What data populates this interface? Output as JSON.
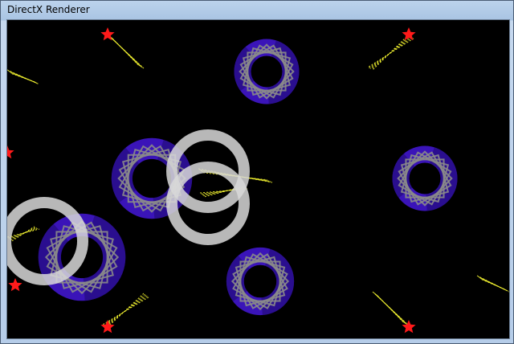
{
  "window": {
    "title": "DirectX Renderer"
  },
  "scene": {
    "background": "#000000",
    "colors": {
      "ring_purple": "#3a14b8",
      "ring_dark": "#1e0a6e",
      "star_outline": "#8a8a8a",
      "white_ring": "#d8d8d8",
      "star_red": "#ff1a1a",
      "streak_yellow": "#ffff33"
    },
    "icons": [
      "red-star-icon",
      "gear-ring",
      "white-ring",
      "yellow-streak"
    ]
  }
}
